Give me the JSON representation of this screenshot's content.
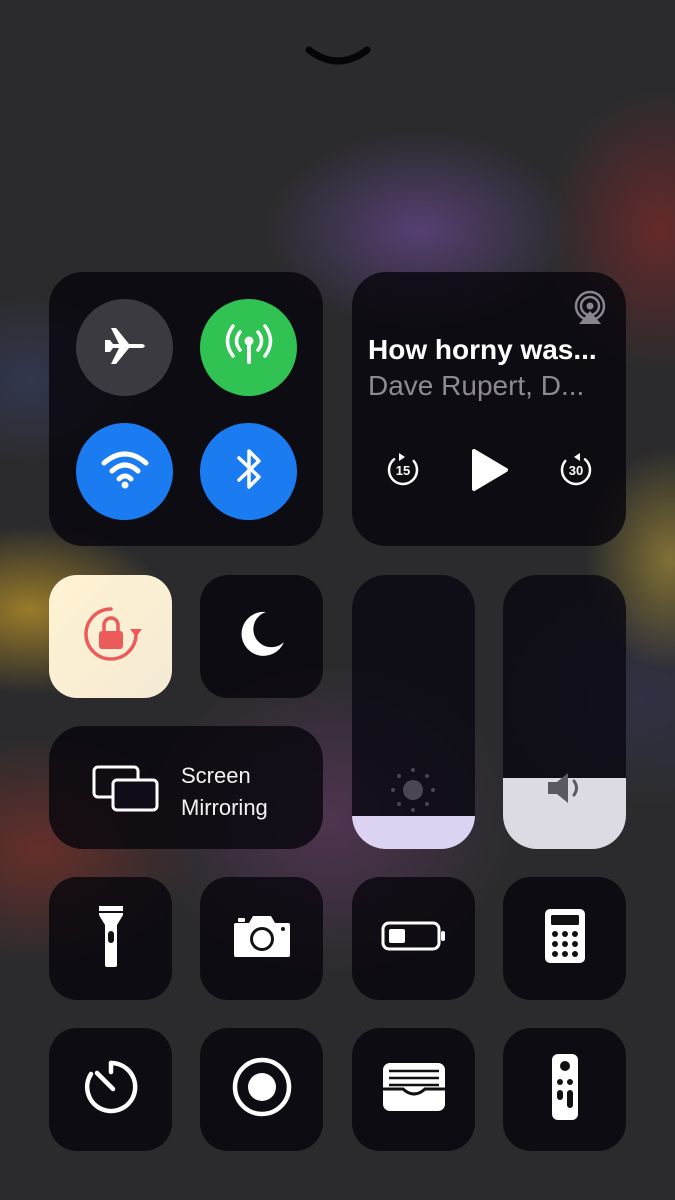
{
  "grabber_icon": "chevron-down-icon",
  "connectivity": {
    "airplane": {
      "icon": "airplane-icon",
      "on": false,
      "color": "#3a3a40"
    },
    "cellular": {
      "icon": "cellular-antenna-icon",
      "on": true,
      "color": "#31c254"
    },
    "wifi": {
      "icon": "wifi-icon",
      "on": true,
      "color": "#1b7cf2"
    },
    "bluetooth": {
      "icon": "bluetooth-icon",
      "on": true,
      "color": "#1b7cf2"
    }
  },
  "now_playing": {
    "title": "How horny was...",
    "subtitle": "Dave Rupert, D...",
    "skip_back_label": "15",
    "skip_forward_label": "30",
    "airplay_icon": "airplay-audio-icon",
    "play_icon": "play-icon"
  },
  "orientation_lock": {
    "icon": "orientation-lock-icon",
    "on": true,
    "accent": "#ec5a5a"
  },
  "do_not_disturb": {
    "icon": "moon-icon",
    "on": false
  },
  "screen_mirroring": {
    "line1": "Screen",
    "line2": "Mirroring",
    "icon": "screen-mirroring-icon"
  },
  "brightness": {
    "icon": "sun-icon",
    "level": 0.12
  },
  "volume": {
    "icon": "speaker-icon",
    "level": 0.26
  },
  "shortcuts": [
    {
      "icon": "flashlight-icon"
    },
    {
      "icon": "camera-icon"
    },
    {
      "icon": "low-power-battery-icon"
    },
    {
      "icon": "calculator-icon"
    },
    {
      "icon": "timer-icon"
    },
    {
      "icon": "screen-record-icon"
    },
    {
      "icon": "wallet-icon"
    },
    {
      "icon": "apple-tv-remote-icon"
    }
  ]
}
